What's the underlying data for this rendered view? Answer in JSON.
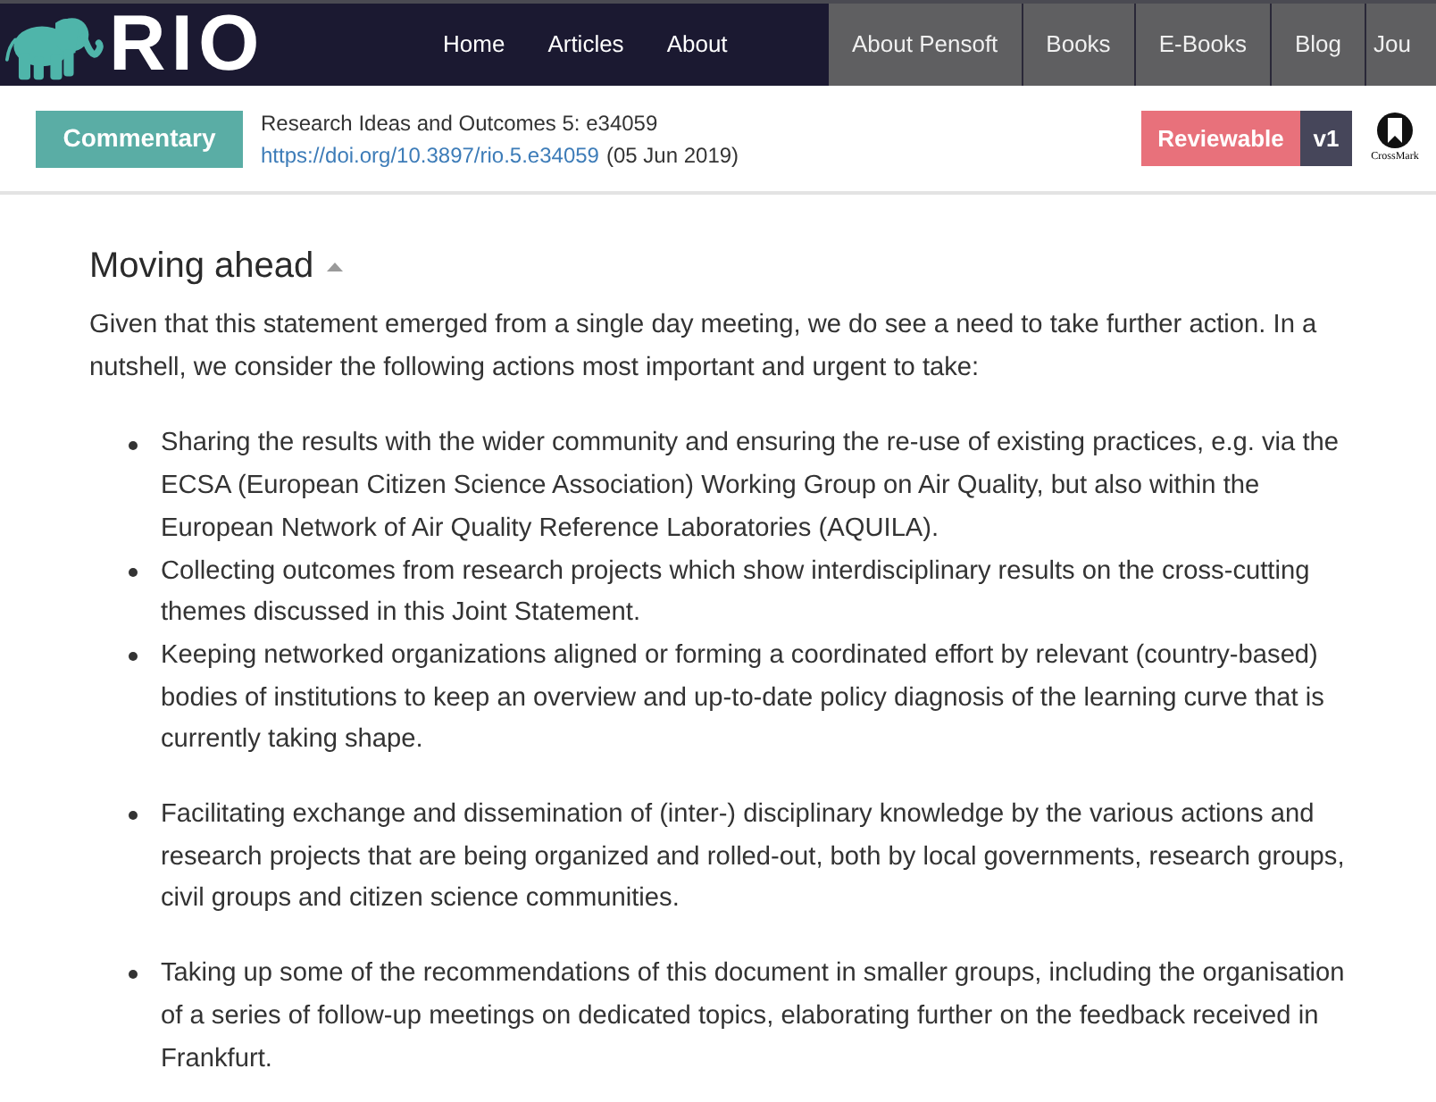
{
  "header": {
    "logo_text": "RIO",
    "nav_links": [
      {
        "label": "Home"
      },
      {
        "label": "Articles"
      },
      {
        "label": "About"
      }
    ],
    "network_links": [
      {
        "label": "About Pensoft"
      },
      {
        "label": "Books"
      },
      {
        "label": "E-Books"
      },
      {
        "label": "Blog"
      },
      {
        "label": "Jou"
      }
    ]
  },
  "article_bar": {
    "type_badge": "Commentary",
    "journal_citation": "Research Ideas and Outcomes 5: e34059",
    "doi_link": "https://doi.org/10.3897/rio.5.e34059",
    "date": "(05 Jun 2019)",
    "status_badge": "Reviewable",
    "version_badge": "v1",
    "crossmark_label": "CrossMark"
  },
  "section": {
    "heading": "Moving ahead",
    "expanded": true,
    "intro": "Given that this statement emerged from a single day meeting, we do see a need to take further action. In a nutshell, we consider the following actions most important and urgent to take:",
    "bullet_lists": [
      {
        "items": [
          "Sharing the results with the wider community and ensuring the re-use of existing practices, e.g. via the ECSA (European Citizen Science Association) Working Group on Air Quality, but also within the European Network of Air Quality Reference Laboratories (AQUILA).",
          "Collecting outcomes from research projects which show interdisciplinary results on the cross-cutting themes discussed in this Joint Statement.",
          "Keeping networked organizations aligned or forming a coordinated effort by relevant (country-based) bodies of institutions to keep an overview and up-to-date policy diagnosis of the learning curve that is currently taking shape."
        ]
      },
      {
        "items": [
          "Facilitating exchange and dissemination of (inter-) disciplinary knowledge by the various actions and research projects that are being organized and rolled-out, both by local governments, research groups, civil groups and citizen science communities."
        ]
      },
      {
        "items": [
          "Taking up some of the recommendations of this document in smaller groups, including the organisation of a series of follow-up meetings on dedicated topics, elaborating further on the feedback received in Frankfurt."
        ]
      }
    ]
  }
}
